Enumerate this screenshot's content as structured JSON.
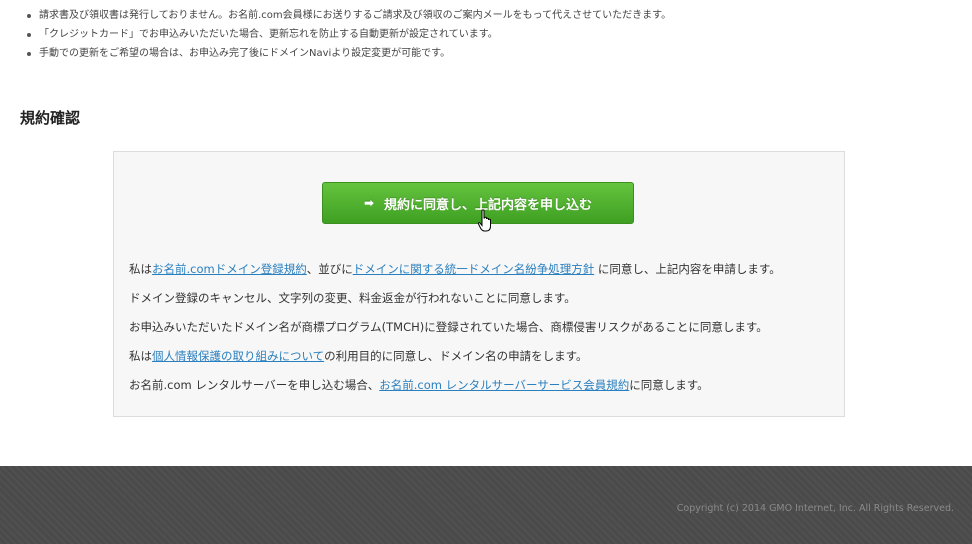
{
  "notes": [
    "請求書及び領収書は発行しておりません。お名前.com会員様にお送りするご請求及び領収のご案内メールをもって代えさせていただきます。",
    "「クレジットカード」でお申込みいただいた場合、更新忘れを防止する自動更新が設定されています。",
    "手動での更新をご希望の場合は、お申込み完了後にドメインNaviより設定変更が可能です。"
  ],
  "section": {
    "title": "規約確認"
  },
  "apply_button": {
    "label": "規約に同意し、上記内容を申し込む"
  },
  "terms": {
    "line1": {
      "pre": "私は",
      "link1": "お名前.comドメイン登録規約",
      "mid": "、並びに",
      "link2": "ドメインに関する統一ドメイン名紛争処理方針",
      "post": " に同意し、上記内容を申請します。"
    },
    "line2": "ドメイン登録のキャンセル、文字列の変更、料金返金が行われないことに同意します。",
    "line3": "お申込みいただいたドメイン名が商標プログラム(TMCH)に登録されていた場合、商標侵害リスクがあることに同意します。",
    "line4": {
      "pre": "私は",
      "link": "個人情報保護の取り組みについて",
      "post": "の利用目的に同意し、ドメイン名の申請をします。"
    },
    "line5": {
      "pre": "お名前.com レンタルサーバーを申し込む場合、",
      "link": "お名前.com レンタルサーバーサービス会員規約",
      "post": "に同意します。"
    }
  },
  "footer": {
    "copyright": "Copyright (c) 2014 GMO Internet, Inc. All Rights Reserved."
  },
  "colors": {
    "button": "#4cae2c",
    "link": "#2a7fbf",
    "footer": "#4a4a4a"
  }
}
